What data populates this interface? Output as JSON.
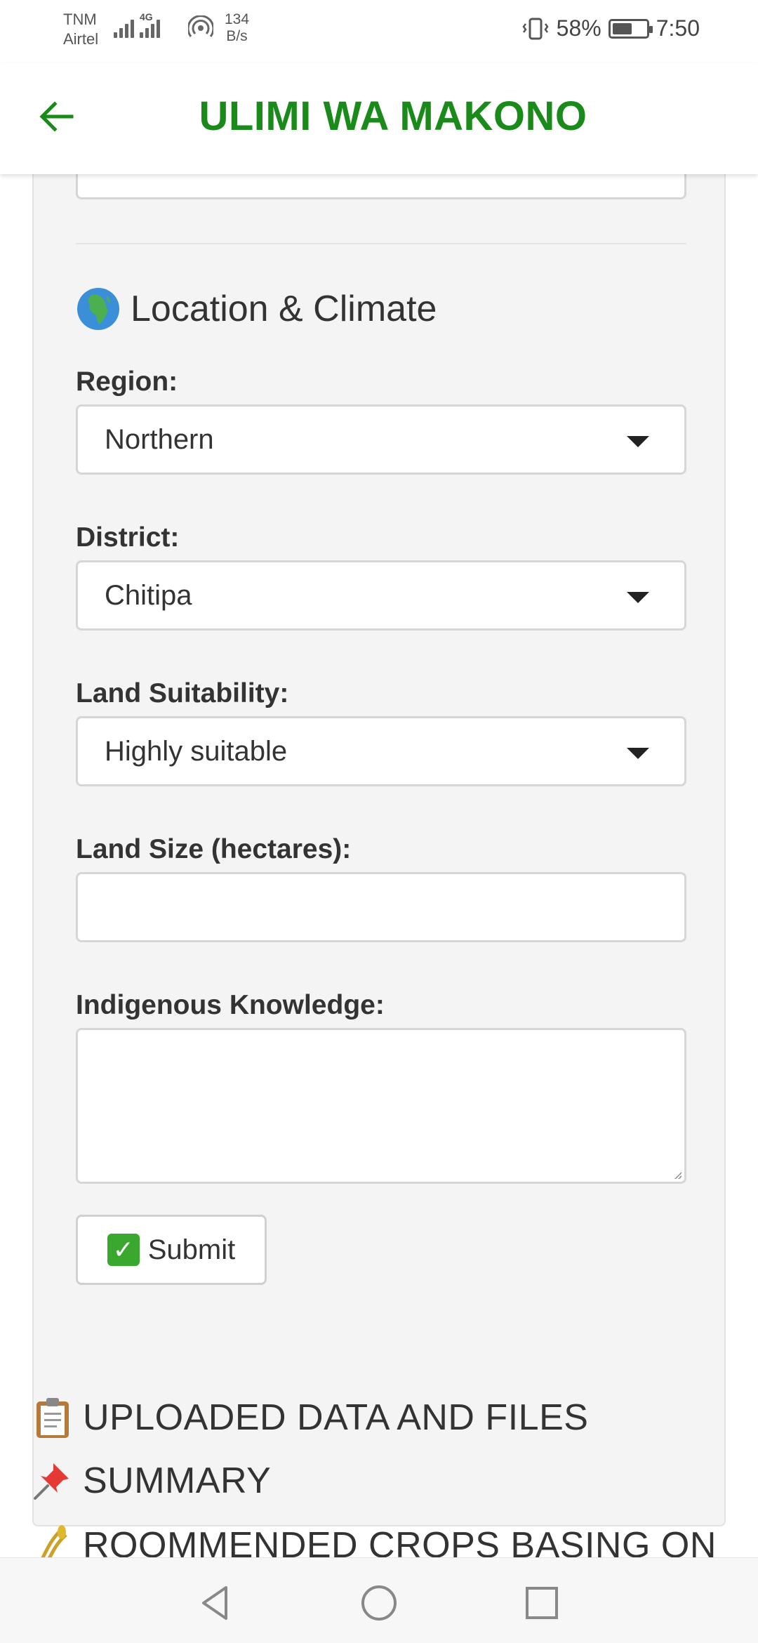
{
  "status_bar": {
    "carrier_line1": "TNM",
    "carrier_line2": "Airtel",
    "network_type": "4G",
    "net_speed_value": "134",
    "net_speed_unit": "B/s",
    "battery_percent": "58%",
    "battery_level": 0.58,
    "time": "7:50"
  },
  "app_bar": {
    "title": "ULIMI WA MAKONO",
    "title_color": "#1a8a1a",
    "back_icon": "arrow-left-icon"
  },
  "form": {
    "section_heading": "Location & Climate",
    "section_icon": "globe-africa-icon",
    "region": {
      "label": "Region:",
      "value": "Northern"
    },
    "district": {
      "label": "District:",
      "value": "Chitipa"
    },
    "land_suitability": {
      "label": "Land Suitability:",
      "value": "Highly suitable"
    },
    "land_size": {
      "label": "Land Size (hectares):",
      "value": ""
    },
    "indigenous_knowledge": {
      "label": "Indigenous Knowledge:",
      "value": ""
    },
    "submit_label": "Submit",
    "submit_icon": "check-mark-button-icon"
  },
  "summary": {
    "line1": "UPLOADED DATA AND FILES",
    "line1_icon": "clipboard-icon",
    "line2": "SUMMARY",
    "line2_icon": "pushpin-icon",
    "line3": "ROOMMENDED CROPS BASING ON",
    "line3_icon": "sheaf-of-rice-icon"
  },
  "nav_bar": {
    "back": "triangle-back-icon",
    "home": "circle-home-icon",
    "recents": "square-recents-icon"
  }
}
